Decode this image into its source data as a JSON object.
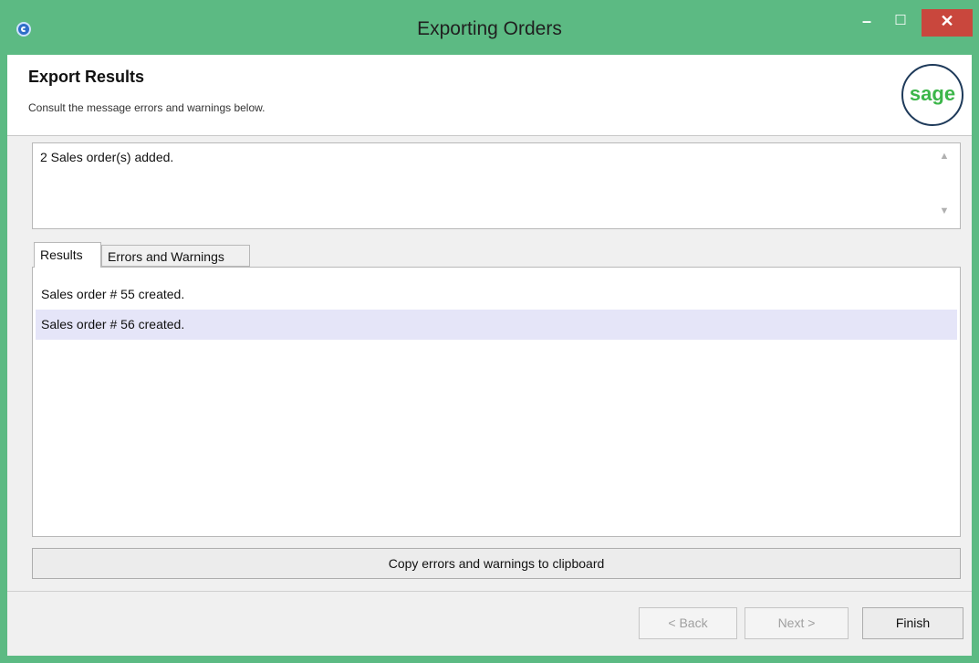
{
  "window": {
    "title": "Exporting Orders",
    "minimize_glyph": "–",
    "maximize_glyph": "☐",
    "close_glyph": "✕",
    "icon": "app-icon"
  },
  "header": {
    "title": "Export Results",
    "subtitle": "Consult the message errors and warnings below.",
    "logo_text": "sage"
  },
  "summary": {
    "text": "2 Sales order(s) added."
  },
  "tabs": [
    {
      "label": "Results",
      "active": true
    },
    {
      "label": "Errors and Warnings",
      "active": false
    }
  ],
  "results": [
    {
      "text": "Sales order # 55 created.",
      "selected": false
    },
    {
      "text": "Sales order # 56 created.",
      "selected": true
    }
  ],
  "buttons": {
    "copy": "Copy errors and warnings to clipboard",
    "back": "< Back",
    "next": "Next >",
    "finish": "Finish"
  },
  "colors": {
    "titlebar": "#5cba83",
    "close": "#c9473d",
    "selected_row": "#e5e5f8",
    "logo_green": "#3cb64a"
  }
}
